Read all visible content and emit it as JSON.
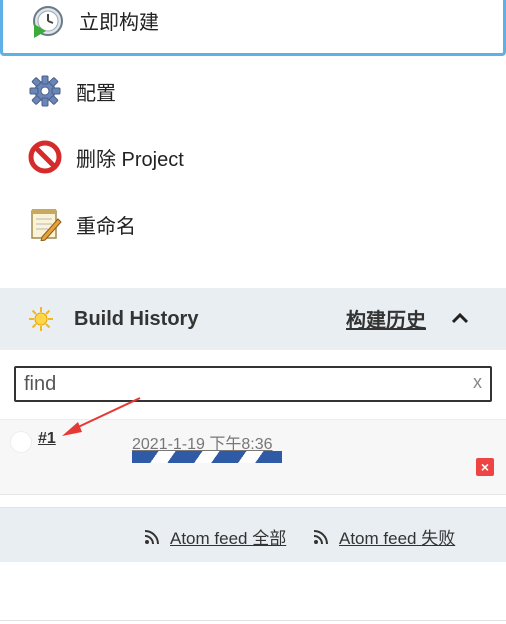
{
  "tasks": [
    {
      "label": "立即构建",
      "icon": "build-now-icon"
    },
    {
      "label": "配置",
      "icon": "gear-icon"
    },
    {
      "label": "删除 Project",
      "icon": "delete-icon"
    },
    {
      "label": "重命名",
      "icon": "notepad-icon"
    }
  ],
  "build_history": {
    "title": "Build History",
    "trend_label": "构建历史",
    "search_placeholder": "find",
    "clear_label": "x",
    "builds": [
      {
        "number": "#1",
        "time": "2021-1-19 下午8:36",
        "progress": 1.0
      }
    ]
  },
  "feeds": {
    "all_label": "Atom feed 全部",
    "failed_label": "Atom feed 失败"
  },
  "colors": {
    "accent_border": "#5fb0e6",
    "header_bg": "#e9eef2",
    "progress_blue": "#2f5aa6",
    "cancel_red": "#e44444",
    "arrow_red": "#e53935"
  }
}
